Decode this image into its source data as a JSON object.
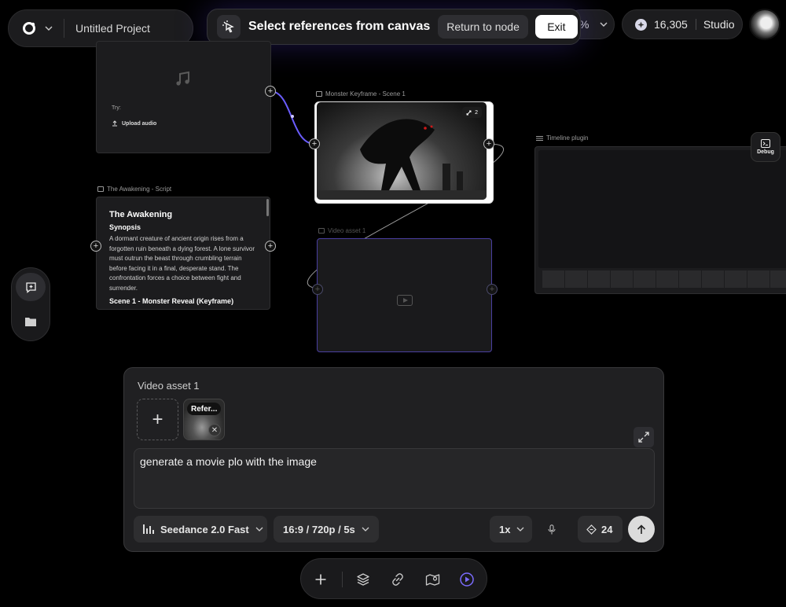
{
  "header": {
    "project_title": "Untitled Project",
    "zoom_fragment": "%",
    "credits": "16,305",
    "plan": "Studio"
  },
  "selection_banner": {
    "text": "Select references from canvas",
    "return_label": "Return to node",
    "exit_label": "Exit"
  },
  "nodes": {
    "audio": {
      "try_label": "Try:",
      "upload_label": "Upload audio"
    },
    "keyframe": {
      "label": "Monster Keyframe - Scene 1",
      "badge": "2"
    },
    "script": {
      "label": "The Awakening - Script",
      "title": "The Awakening",
      "synopsis_heading": "Synopsis",
      "synopsis": "A dormant creature of ancient origin rises from a forgotten ruin beneath a dying forest. A lone survivor must outrun the beast through crumbling terrain before facing it in a final, desperate stand. The confrontation forces a choice between fight and surrender.",
      "scene_heading": "Scene 1 - Monster Reveal (Keyframe)"
    },
    "video": {
      "label": "Video asset 1"
    },
    "timeline": {
      "label": "Timeline plugin"
    }
  },
  "debug_label": "Debug",
  "composer": {
    "title": "Video asset 1",
    "reference_tag": "Refer...",
    "prompt_value": "generate a movie plo with the image",
    "model": "Seedance 2.0 Fast",
    "format": "16:9 / 720p / 5s",
    "speed": "1x",
    "cost": "24"
  },
  "icons": {
    "logo": "logo-icon",
    "cursor": "select-cursor-icon",
    "music": "music-note-icon",
    "upload": "upload-icon",
    "expand": "expand-icon",
    "mic": "microphone-icon",
    "send": "arrow-up-icon"
  },
  "colors": {
    "accent": "#7b6cff",
    "panel": "#1c1c1e",
    "background": "#000000"
  }
}
